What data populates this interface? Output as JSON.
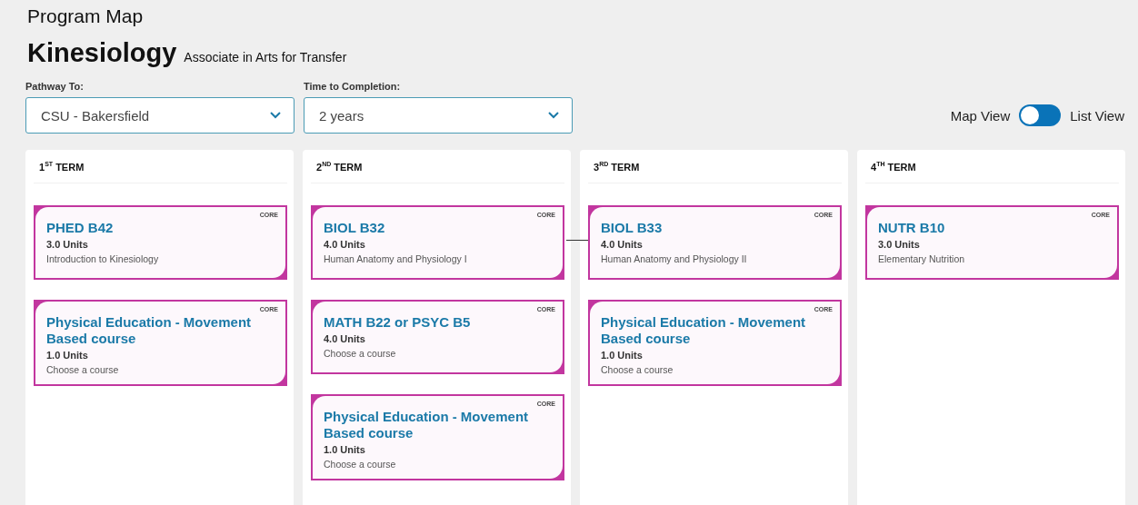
{
  "page_title": "Program Map",
  "program": {
    "name": "Kinesiology",
    "degree": "Associate in Arts for Transfer"
  },
  "filters": [
    {
      "label": "Pathway To:",
      "value": "CSU - Bakersfield"
    },
    {
      "label": "Time to Completion:",
      "value": "2 years"
    }
  ],
  "view_toggle": {
    "left_label": "Map View",
    "right_label": "List View",
    "on": false
  },
  "terms": [
    {
      "title": "1$^{ST}$ TERM",
      "courses": [
        {
          "tag": "CORE",
          "code": "PHED B42",
          "units": "3.0 Units",
          "description": "Introduction to Kinesiology",
          "linked_to_next_term": false
        },
        {
          "tag": "CORE",
          "code": "Physical Education - Movement Based course",
          "units": "1.0 Units",
          "description": "Choose a course",
          "linked_to_next_term": false
        }
      ]
    },
    {
      "title": "2$^{ND}$ TERM",
      "courses": [
        {
          "tag": "CORE",
          "code": "BIOL B32",
          "units": "4.0 Units",
          "description": "Human Anatomy and Physiology I",
          "linked_to_next_term": true
        },
        {
          "tag": "CORE",
          "code": "MATH B22 or PSYC B5",
          "units": "4.0 Units",
          "description": "Choose a course",
          "linked_to_next_term": false
        },
        {
          "tag": "CORE",
          "code": "Physical Education - Movement Based course",
          "units": "1.0 Units",
          "description": "Choose a course",
          "linked_to_next_term": false
        }
      ]
    },
    {
      "title": "3$^{RD}$ TERM",
      "courses": [
        {
          "tag": "CORE",
          "code": "BIOL B33",
          "units": "4.0 Units",
          "description": "Human Anatomy and Physiology II",
          "linked_to_next_term": false
        },
        {
          "tag": "CORE",
          "code": "Physical Education - Movement Based course",
          "units": "1.0 Units",
          "description": "Choose a course",
          "linked_to_next_term": false
        }
      ]
    },
    {
      "title": "4$^{TH}$ TERM",
      "courses": [
        {
          "tag": "CORE",
          "code": "NUTR B10",
          "units": "3.0 Units",
          "description": "Elementary Nutrition",
          "linked_to_next_term": false
        }
      ]
    }
  ]
}
